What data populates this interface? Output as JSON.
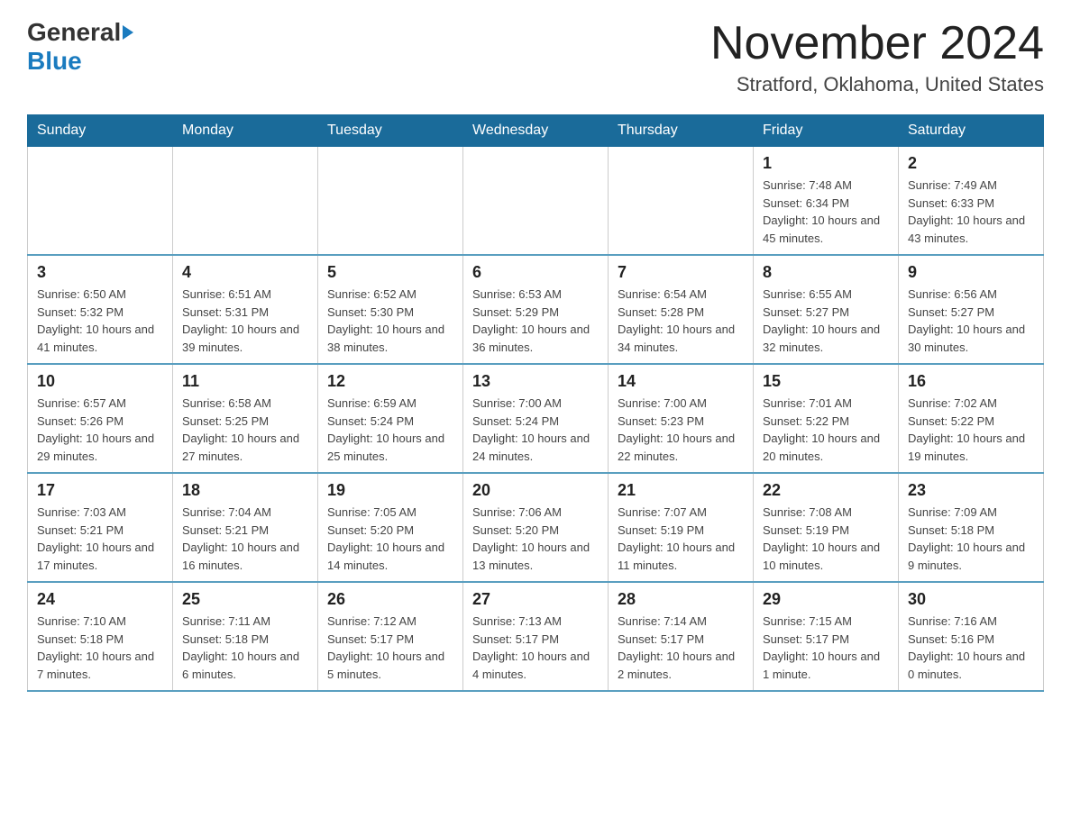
{
  "header": {
    "logo_general": "General",
    "logo_blue": "Blue",
    "month_title": "November 2024",
    "location": "Stratford, Oklahoma, United States"
  },
  "calendar": {
    "days_of_week": [
      "Sunday",
      "Monday",
      "Tuesday",
      "Wednesday",
      "Thursday",
      "Friday",
      "Saturday"
    ],
    "weeks": [
      [
        {
          "day": "",
          "info": ""
        },
        {
          "day": "",
          "info": ""
        },
        {
          "day": "",
          "info": ""
        },
        {
          "day": "",
          "info": ""
        },
        {
          "day": "",
          "info": ""
        },
        {
          "day": "1",
          "info": "Sunrise: 7:48 AM\nSunset: 6:34 PM\nDaylight: 10 hours and 45 minutes."
        },
        {
          "day": "2",
          "info": "Sunrise: 7:49 AM\nSunset: 6:33 PM\nDaylight: 10 hours and 43 minutes."
        }
      ],
      [
        {
          "day": "3",
          "info": "Sunrise: 6:50 AM\nSunset: 5:32 PM\nDaylight: 10 hours and 41 minutes."
        },
        {
          "day": "4",
          "info": "Sunrise: 6:51 AM\nSunset: 5:31 PM\nDaylight: 10 hours and 39 minutes."
        },
        {
          "day": "5",
          "info": "Sunrise: 6:52 AM\nSunset: 5:30 PM\nDaylight: 10 hours and 38 minutes."
        },
        {
          "day": "6",
          "info": "Sunrise: 6:53 AM\nSunset: 5:29 PM\nDaylight: 10 hours and 36 minutes."
        },
        {
          "day": "7",
          "info": "Sunrise: 6:54 AM\nSunset: 5:28 PM\nDaylight: 10 hours and 34 minutes."
        },
        {
          "day": "8",
          "info": "Sunrise: 6:55 AM\nSunset: 5:27 PM\nDaylight: 10 hours and 32 minutes."
        },
        {
          "day": "9",
          "info": "Sunrise: 6:56 AM\nSunset: 5:27 PM\nDaylight: 10 hours and 30 minutes."
        }
      ],
      [
        {
          "day": "10",
          "info": "Sunrise: 6:57 AM\nSunset: 5:26 PM\nDaylight: 10 hours and 29 minutes."
        },
        {
          "day": "11",
          "info": "Sunrise: 6:58 AM\nSunset: 5:25 PM\nDaylight: 10 hours and 27 minutes."
        },
        {
          "day": "12",
          "info": "Sunrise: 6:59 AM\nSunset: 5:24 PM\nDaylight: 10 hours and 25 minutes."
        },
        {
          "day": "13",
          "info": "Sunrise: 7:00 AM\nSunset: 5:24 PM\nDaylight: 10 hours and 24 minutes."
        },
        {
          "day": "14",
          "info": "Sunrise: 7:00 AM\nSunset: 5:23 PM\nDaylight: 10 hours and 22 minutes."
        },
        {
          "day": "15",
          "info": "Sunrise: 7:01 AM\nSunset: 5:22 PM\nDaylight: 10 hours and 20 minutes."
        },
        {
          "day": "16",
          "info": "Sunrise: 7:02 AM\nSunset: 5:22 PM\nDaylight: 10 hours and 19 minutes."
        }
      ],
      [
        {
          "day": "17",
          "info": "Sunrise: 7:03 AM\nSunset: 5:21 PM\nDaylight: 10 hours and 17 minutes."
        },
        {
          "day": "18",
          "info": "Sunrise: 7:04 AM\nSunset: 5:21 PM\nDaylight: 10 hours and 16 minutes."
        },
        {
          "day": "19",
          "info": "Sunrise: 7:05 AM\nSunset: 5:20 PM\nDaylight: 10 hours and 14 minutes."
        },
        {
          "day": "20",
          "info": "Sunrise: 7:06 AM\nSunset: 5:20 PM\nDaylight: 10 hours and 13 minutes."
        },
        {
          "day": "21",
          "info": "Sunrise: 7:07 AM\nSunset: 5:19 PM\nDaylight: 10 hours and 11 minutes."
        },
        {
          "day": "22",
          "info": "Sunrise: 7:08 AM\nSunset: 5:19 PM\nDaylight: 10 hours and 10 minutes."
        },
        {
          "day": "23",
          "info": "Sunrise: 7:09 AM\nSunset: 5:18 PM\nDaylight: 10 hours and 9 minutes."
        }
      ],
      [
        {
          "day": "24",
          "info": "Sunrise: 7:10 AM\nSunset: 5:18 PM\nDaylight: 10 hours and 7 minutes."
        },
        {
          "day": "25",
          "info": "Sunrise: 7:11 AM\nSunset: 5:18 PM\nDaylight: 10 hours and 6 minutes."
        },
        {
          "day": "26",
          "info": "Sunrise: 7:12 AM\nSunset: 5:17 PM\nDaylight: 10 hours and 5 minutes."
        },
        {
          "day": "27",
          "info": "Sunrise: 7:13 AM\nSunset: 5:17 PM\nDaylight: 10 hours and 4 minutes."
        },
        {
          "day": "28",
          "info": "Sunrise: 7:14 AM\nSunset: 5:17 PM\nDaylight: 10 hours and 2 minutes."
        },
        {
          "day": "29",
          "info": "Sunrise: 7:15 AM\nSunset: 5:17 PM\nDaylight: 10 hours and 1 minute."
        },
        {
          "day": "30",
          "info": "Sunrise: 7:16 AM\nSunset: 5:16 PM\nDaylight: 10 hours and 0 minutes."
        }
      ]
    ]
  }
}
